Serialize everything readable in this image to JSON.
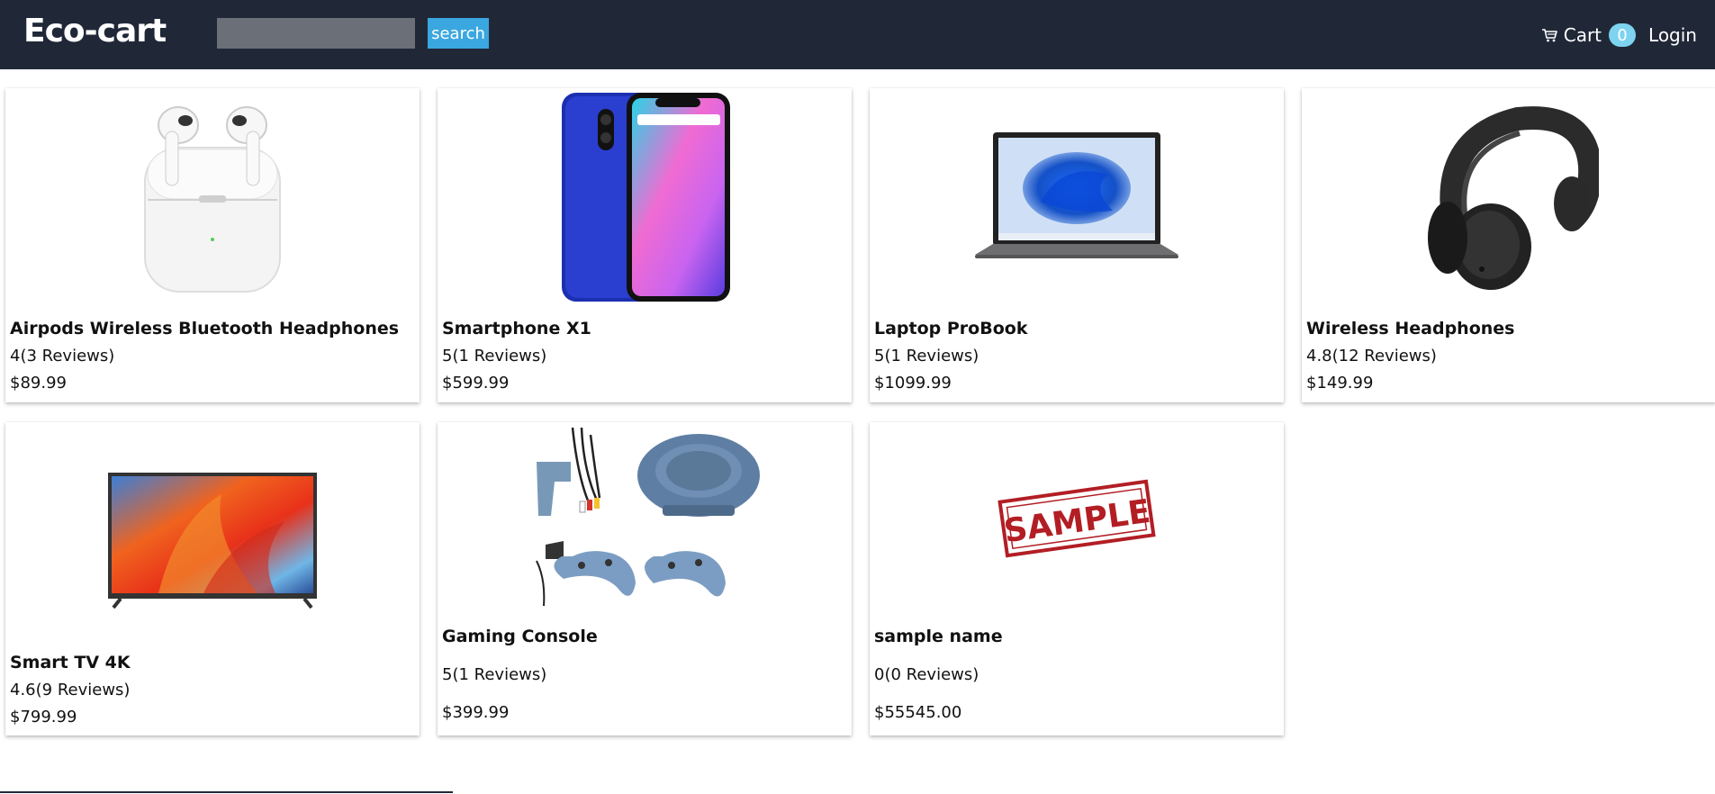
{
  "header": {
    "logo": "Eco-cart",
    "search_placeholder": "",
    "search_button": "search",
    "cart_label": "Cart",
    "cart_count": "0",
    "login_label": "Login"
  },
  "products": [
    {
      "name": "Airpods Wireless Bluetooth Headphones",
      "rating": "4(3 Reviews)",
      "price": "$89.99",
      "image": "airpods"
    },
    {
      "name": "Smartphone X1",
      "rating": "5(1 Reviews)",
      "price": "$599.99",
      "image": "smartphone"
    },
    {
      "name": "Laptop ProBook",
      "rating": "5(1 Reviews)",
      "price": "$1099.99",
      "image": "laptop"
    },
    {
      "name": "Wireless Headphones",
      "rating": "4.8(12 Reviews)",
      "price": "$149.99",
      "image": "headphones"
    },
    {
      "name": "Smart TV 4K",
      "rating": "4.6(9 Reviews)",
      "price": "$799.99",
      "image": "tv"
    },
    {
      "name": "Gaming Console",
      "rating": "5(1 Reviews)",
      "price": "$399.99",
      "image": "console"
    },
    {
      "name": "sample name",
      "rating": "0(0 Reviews)",
      "price": "$55545.00",
      "image": "sample",
      "image_text": "SAMPLE"
    }
  ],
  "colors": {
    "header_bg": "#202838",
    "search_button_bg": "#3aa7e0",
    "cart_badge_bg": "#7dd3f0"
  }
}
